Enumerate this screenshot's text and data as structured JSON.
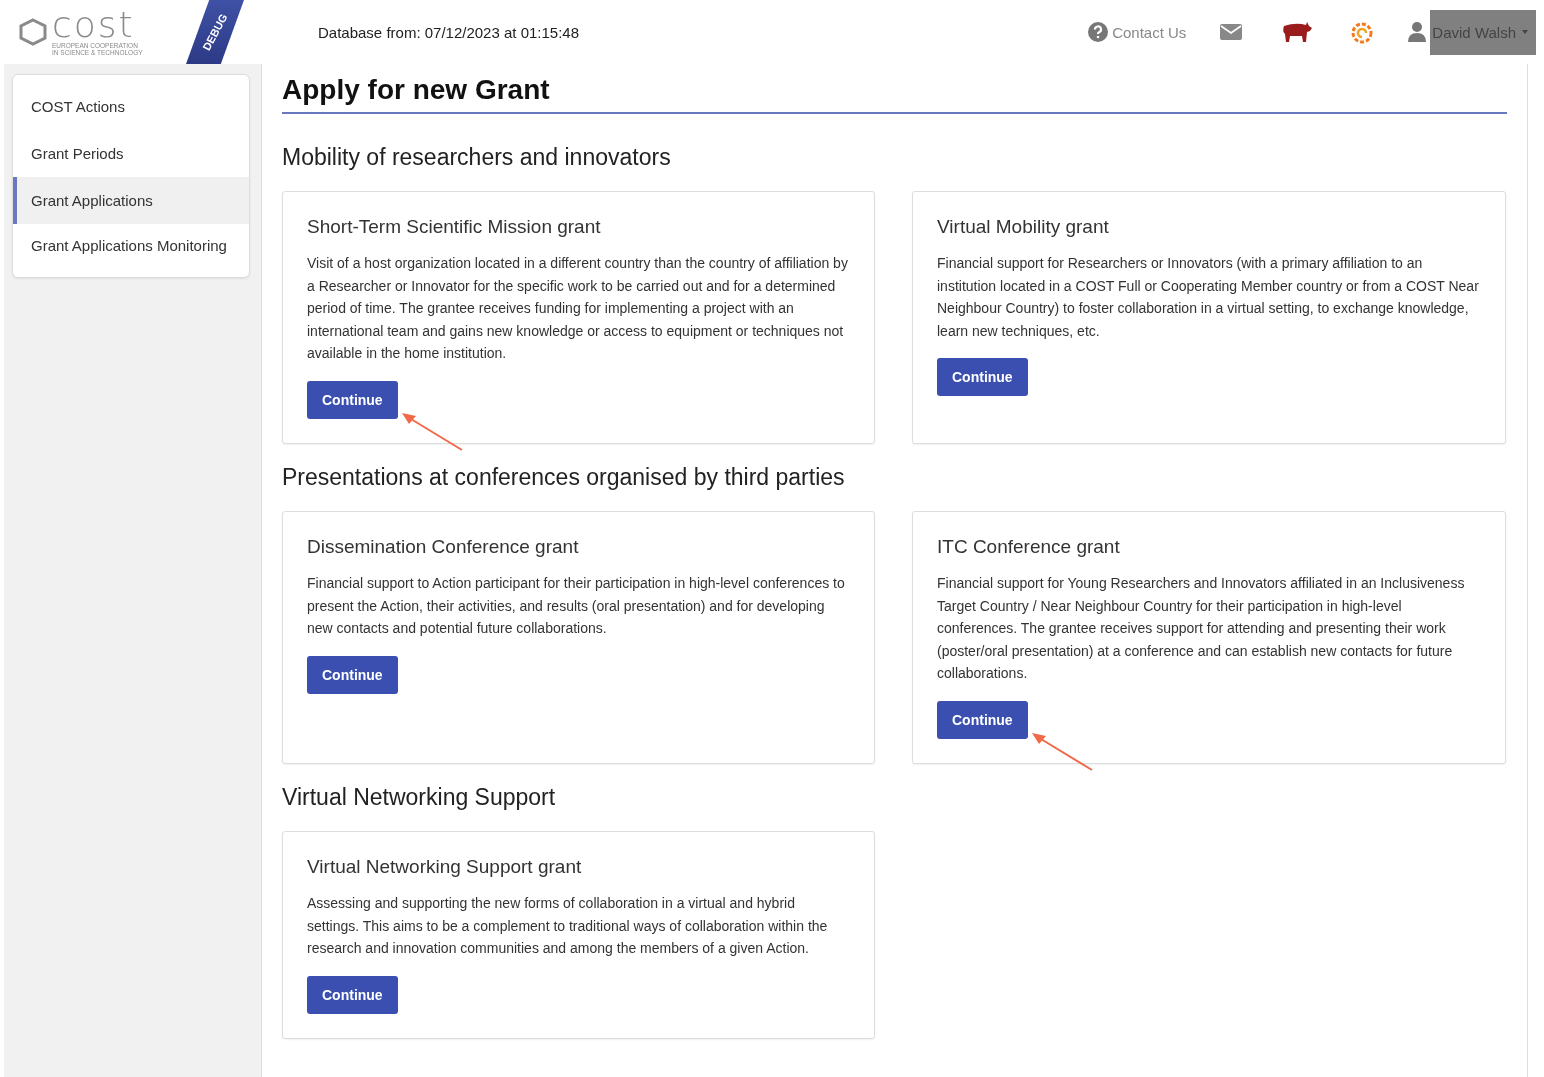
{
  "header": {
    "logo": {
      "word": "cost",
      "tagline_1": "EUROPEAN COOPERATION",
      "tagline_2": "IN SCIENCE & TECHNOLOGY"
    },
    "ribbon": "DEBUG",
    "database_info": "Database from: 07/12/2023 at 01:15:48",
    "contact": "Contact Us",
    "user": "David Walsh"
  },
  "sidebar": {
    "items": [
      {
        "label": "COST Actions",
        "selected": false
      },
      {
        "label": "Grant Periods",
        "selected": false
      },
      {
        "label": "Grant Applications",
        "selected": true
      },
      {
        "label": "Grant Applications Monitoring",
        "selected": false
      }
    ]
  },
  "page_title": "Apply for new Grant",
  "sections": [
    {
      "title": "Mobility of researchers and innovators",
      "grants": [
        {
          "title": "Short-Term Scientific Mission grant",
          "description": "Visit of a host organization located in a different country than the country of affiliation by a Researcher or Innovator for the specific work to be carried out and for a determined period of time. The grantee receives funding for implementing a project with an international team and gains new knowledge or access to equipment or techniques not available in the home institution.",
          "button": "Continue",
          "arrow": true
        },
        {
          "title": "Virtual Mobility grant",
          "description": "Financial support for Researchers or Innovators (with a primary affiliation to an institution located in a COST Full or Cooperating Member country or from a COST Near Neighbour Country) to foster collaboration in a virtual setting, to exchange knowledge, learn new techniques, etc.",
          "button": "Continue",
          "arrow": false
        }
      ]
    },
    {
      "title": "Presentations at conferences organised by third parties",
      "grants": [
        {
          "title": "Dissemination Conference grant",
          "description": "Financial support to Action participant for their participation in high-level conferences to present the Action, their activities, and results (oral presentation) and for developing new contacts and potential future collaborations.",
          "button": "Continue",
          "arrow": false
        },
        {
          "title": "ITC Conference grant",
          "description": "Financial support for Young Researchers and Innovators affiliated in an Inclusiveness Target Country / Near Neighbour Country for their participation in high-level conferences. The grantee receives support for attending and presenting their work (poster/oral presentation) at a conference and can establish new contacts for future collaborations.",
          "button": "Continue",
          "arrow": true
        }
      ]
    },
    {
      "title": "Virtual Networking Support",
      "grants": [
        {
          "title": "Virtual Networking Support grant",
          "description": "Assessing and supporting the new forms of collaboration in a virtual and hybrid settings. This aims to be a complement to traditional ways of collaboration within the research and innovation communities and among the members of a given Action.",
          "button": "Continue",
          "arrow": false
        }
      ]
    }
  ]
}
